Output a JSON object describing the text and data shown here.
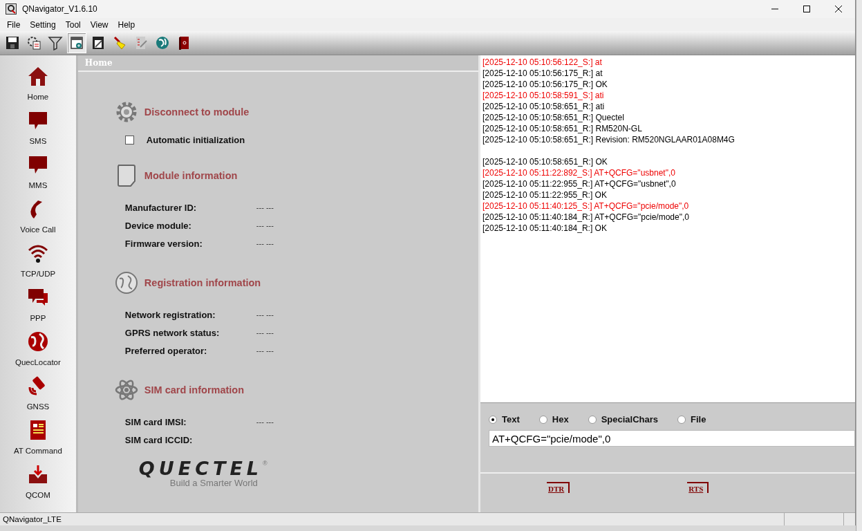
{
  "window": {
    "title": "QNavigator_V1.6.10"
  },
  "menu": [
    "File",
    "Setting",
    "Tool",
    "View",
    "Help"
  ],
  "toolbar": [
    {
      "selected": false
    },
    {
      "selected": false
    },
    {
      "selected": false
    },
    {
      "selected": true
    },
    {
      "selected": false
    },
    {
      "selected": false
    },
    {
      "selected": false
    },
    {
      "selected": false
    },
    {
      "selected": false
    }
  ],
  "sidebar": {
    "items": [
      "Home",
      "SMS",
      "MMS",
      "Voice Call",
      "TCP/UDP",
      "PPP",
      "QuecLocator",
      "GNSS",
      "AT Command",
      "QCOM"
    ]
  },
  "page": {
    "title": "Home",
    "sections": [
      {
        "title": "Disconnect to module",
        "checkbox": {
          "label": "Automatic initialization",
          "checked": false
        }
      },
      {
        "title": "Module information",
        "fields": [
          {
            "label": "Manufacturer ID:",
            "value": "--- ---"
          },
          {
            "label": "Device module:",
            "value": "--- ---"
          },
          {
            "label": "Firmware version:",
            "value": "--- ---"
          }
        ]
      },
      {
        "title": "Registration information",
        "fields": [
          {
            "label": "Network registration:",
            "value": "--- ---"
          },
          {
            "label": "GPRS network status:",
            "value": "--- ---"
          },
          {
            "label": "Preferred operator:",
            "value": "--- ---"
          }
        ]
      },
      {
        "title": "SIM card information",
        "fields": [
          {
            "label": "SIM card IMSI:",
            "value": "--- ---"
          },
          {
            "label": "SIM card ICCID:"
          }
        ]
      }
    ],
    "logo": {
      "name": "QUECTEL",
      "mark": "®",
      "slogan": "Build a Smarter World"
    }
  },
  "log": [
    {
      "kind": "sent",
      "text": "[2025-12-10 05:10:56:122_S:] at"
    },
    {
      "kind": "received",
      "text": "[2025-12-10 05:10:56:175_R:] at"
    },
    {
      "kind": "received",
      "text": "[2025-12-10 05:10:56:175_R:] OK"
    },
    {
      "kind": "sent",
      "text": "[2025-12-10 05:10:58:591_S:] ati"
    },
    {
      "kind": "received",
      "text": "[2025-12-10 05:10:58:651_R:] ati"
    },
    {
      "kind": "received",
      "text": "[2025-12-10 05:10:58:651_R:] Quectel"
    },
    {
      "kind": "received",
      "text": "[2025-12-10 05:10:58:651_R:] RM520N-GL"
    },
    {
      "kind": "received",
      "text": "[2025-12-10 05:10:58:651_R:] Revision: RM520NGLAAR01A08M4G"
    },
    {
      "kind": "received",
      "text": "[2025-12-10 05:10:58:651_R:] OK",
      "blank_before": true
    },
    {
      "kind": "sent",
      "text": "[2025-12-10 05:11:22:892_S:] AT+QCFG=\"usbnet\",0"
    },
    {
      "kind": "received",
      "text": "[2025-12-10 05:11:22:955_R:] AT+QCFG=\"usbnet\",0"
    },
    {
      "kind": "received",
      "text": "[2025-12-10 05:11:22:955_R:] OK"
    },
    {
      "kind": "sent",
      "text": "[2025-12-10 05:11:40:125_S:] AT+QCFG=\"pcie/mode\",0"
    },
    {
      "kind": "received",
      "text": "[2025-12-10 05:11:40:184_R:] AT+QCFG=\"pcie/mode\",0"
    },
    {
      "kind": "received",
      "text": "[2025-12-10 05:11:40:184_R:] OK"
    }
  ],
  "send_modes": [
    {
      "label": "Text",
      "selected": true
    },
    {
      "label": "Hex",
      "selected": false
    },
    {
      "label": "SpecialChars",
      "selected": false
    },
    {
      "label": "File",
      "selected": false
    }
  ],
  "command_input": {
    "value": "AT+QCFG=\"pcie/mode\",0"
  },
  "signals": [
    "DTR",
    "RTS"
  ],
  "status_bar": {
    "text": "QNavigator_LTE"
  }
}
